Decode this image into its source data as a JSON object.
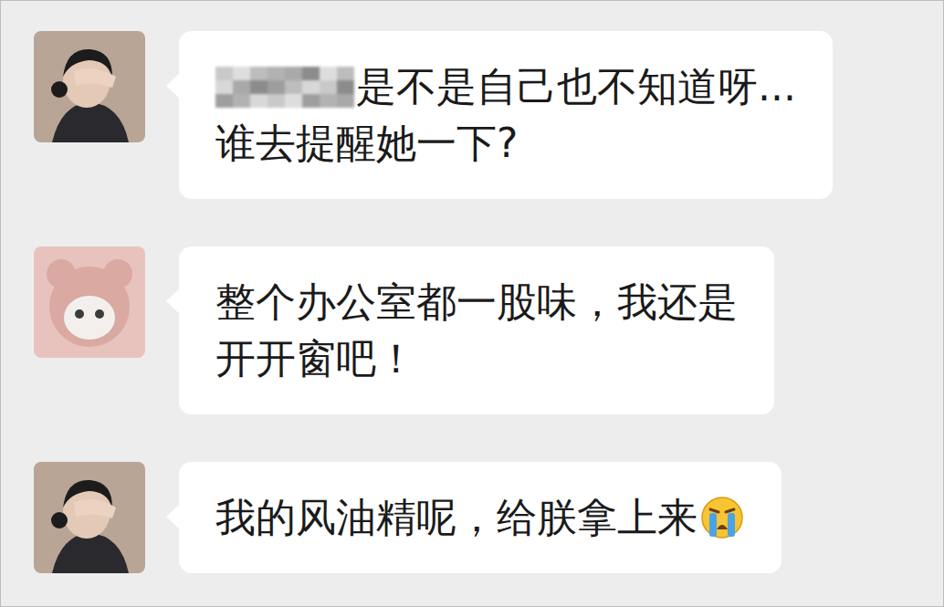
{
  "messages": [
    {
      "color": "#b9a596",
      "redacted_prefix": true,
      "emoji_icon": false,
      "lines": [
        "是不是自己也不知道呀...",
        "谁去提醒她一下?"
      ]
    },
    {
      "color": "#e8c3bd",
      "redacted_prefix": false,
      "emoji_icon": false,
      "lines": [
        "整个办公室都一股味，我还是",
        "开开窗吧！"
      ]
    },
    {
      "color": "#b9a596",
      "redacted_prefix": false,
      "emoji_icon": true,
      "lines": [
        "我的风油精呢，给朕拿上来"
      ]
    }
  ]
}
